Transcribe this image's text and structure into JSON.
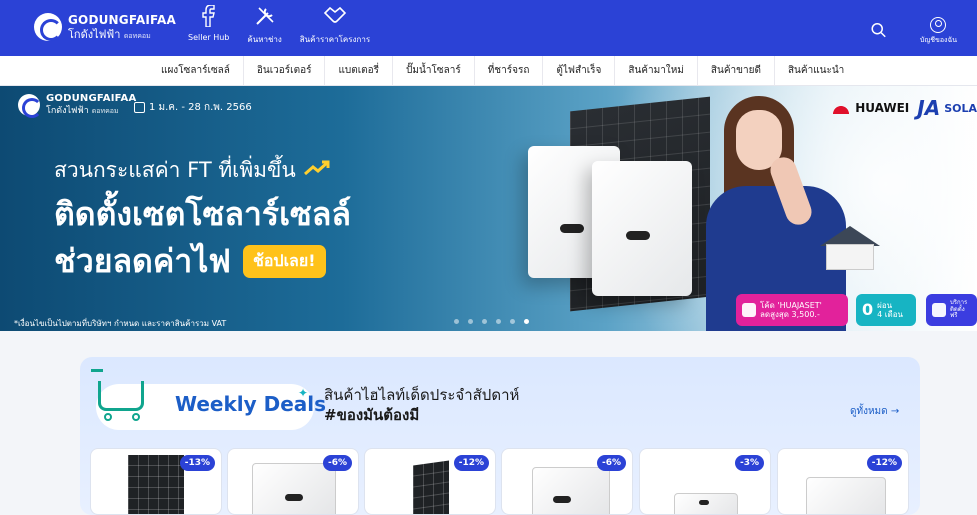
{
  "header": {
    "logo_name": "GODUNGFAIFAA",
    "logo_thai": "โกดังไฟฟ้า",
    "logo_suffix": "ดอทคอม",
    "nav": [
      {
        "label": "Seller Hub",
        "icon": "facebook-icon"
      },
      {
        "label": "ค้นหาช่าง",
        "icon": "wrench-screwdriver-icon"
      },
      {
        "label": "สินค้าราคาโครงการ",
        "icon": "handshake-icon"
      }
    ],
    "search_icon": "search-icon",
    "account_label": "บัญชีของฉัน",
    "account_icon": "user-circle-icon"
  },
  "categories": [
    "แผงโซลาร์เซลล์",
    "อินเวอร์เตอร์",
    "แบตเตอรี่",
    "ปั๊มน้ำโซลาร์",
    "ที่ชาร์จรถ",
    "ตู้ไฟสำเร็จ",
    "สินค้ามาใหม่",
    "สินค้าขายดี",
    "สินค้าแนะนำ"
  ],
  "hero": {
    "logo_name": "GODUNGFAIFAA",
    "logo_thai": "โกดังไฟฟ้า",
    "logo_suffix": "ดอทคอม",
    "date_range": "1 ม.ค. - 28 ก.พ. 2566",
    "brand_1": "HUAWEI",
    "brand_2": "JA",
    "brand_2_suffix": "SOLA",
    "headline_1": "สวนกระแสค่า FT ที่เพิ่มขึ้น",
    "headline_2": "ติดตั้งเซตโซลาร์เซลล์",
    "headline_3": "ช่วยลดค่าไฟ",
    "cta_label": "ช้อปเลย!",
    "disclaimer": "*เงื่อนไขเป็นไปตามที่บริษัทฯ กำหนด และราคาสินค้ารวม VAT",
    "slide_count": 6,
    "active_slide": 6,
    "promos": [
      {
        "line1": "โค้ด 'HUAJASET'",
        "line2": "ลดสูงสุด 3,500.-",
        "color": "#e2229b"
      },
      {
        "big": "0",
        "line1": "ผ่อน",
        "line2": "4 เดือน",
        "color": "#17b4c3"
      },
      {
        "line1": "บริการ",
        "line2": "ติดตั้ง",
        "line3": "ฟรี",
        "color": "#3b3de0"
      }
    ]
  },
  "deals": {
    "title": "Weekly Deals",
    "subtitle": "สินค้าไฮไลท์เด็ดประจำสัปดาห์",
    "hashtag": "#ของมันต้องมี",
    "see_all": "ดูทั้งหมด →",
    "products": [
      {
        "discount": "-13%",
        "type": "panel"
      },
      {
        "discount": "-6%",
        "type": "inverter"
      },
      {
        "discount": "-12%",
        "type": "panel-angled"
      },
      {
        "discount": "-6%",
        "type": "inverter"
      },
      {
        "discount": "-3%",
        "type": "battery"
      },
      {
        "discount": "-12%",
        "type": "cabinet"
      }
    ]
  },
  "colors": {
    "brand_blue": "#2b42d6",
    "cta_yellow": "#ffc21a",
    "deals_teal": "#10a58e",
    "deals_blue": "#1c5ec7"
  }
}
